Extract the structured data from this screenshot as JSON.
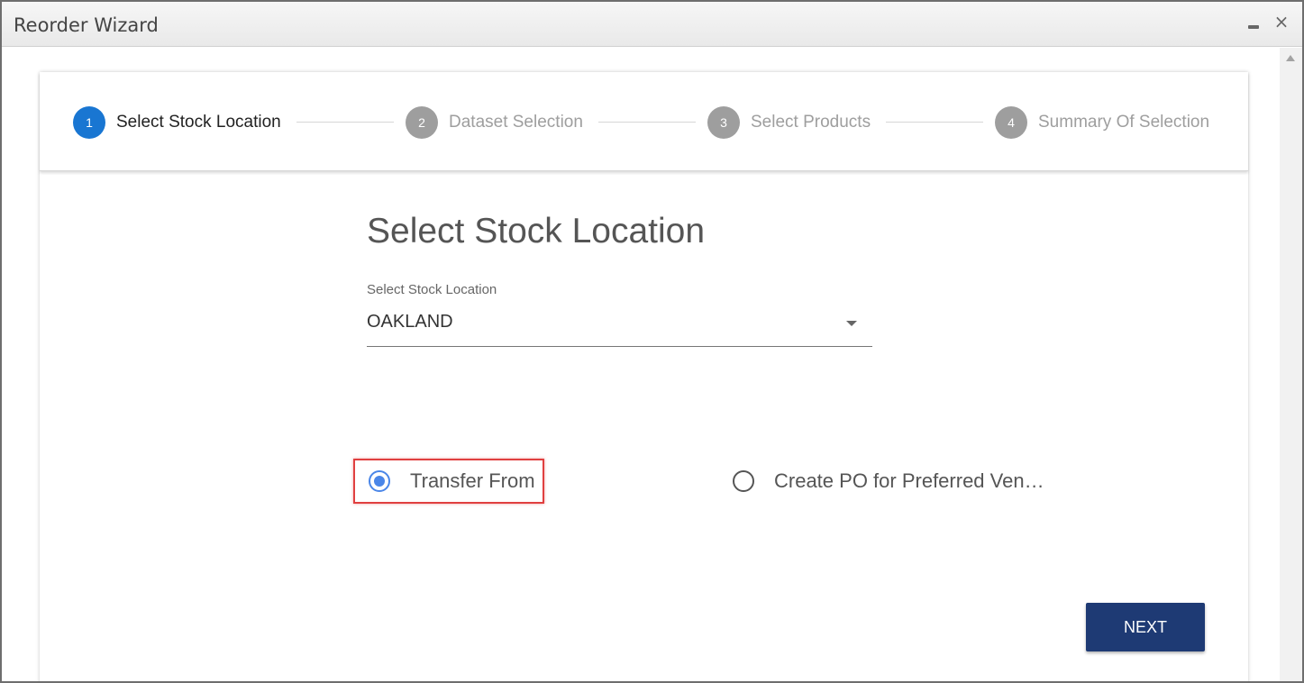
{
  "window": {
    "title": "Reorder Wizard",
    "close_glyph": "×"
  },
  "stepper": {
    "steps": [
      {
        "number": "1",
        "label": "Select Stock Location",
        "active": true
      },
      {
        "number": "2",
        "label": "Dataset Selection",
        "active": false
      },
      {
        "number": "3",
        "label": "Select Products",
        "active": false
      },
      {
        "number": "4",
        "label": "Summary Of Selection",
        "active": false
      }
    ]
  },
  "main": {
    "heading": "Select Stock Location",
    "stock_location": {
      "label": "Select Stock Location",
      "value": "OAKLAND"
    },
    "options": [
      {
        "label": "Transfer From",
        "checked": true
      },
      {
        "label": "Create PO for Preferred Ven…",
        "checked": false
      }
    ],
    "next_label": "NEXT"
  },
  "colors": {
    "active_step": "#1976d2",
    "inactive_step": "#9e9e9e",
    "radio_checked": "#4a86e8",
    "highlight": "#e04040",
    "next_button": "#1e3a74"
  },
  "icons": {
    "minimize": "minimize-icon",
    "close": "close-icon",
    "dropdown": "caret-down-icon",
    "scroll_up": "scroll-up-arrow-icon"
  }
}
